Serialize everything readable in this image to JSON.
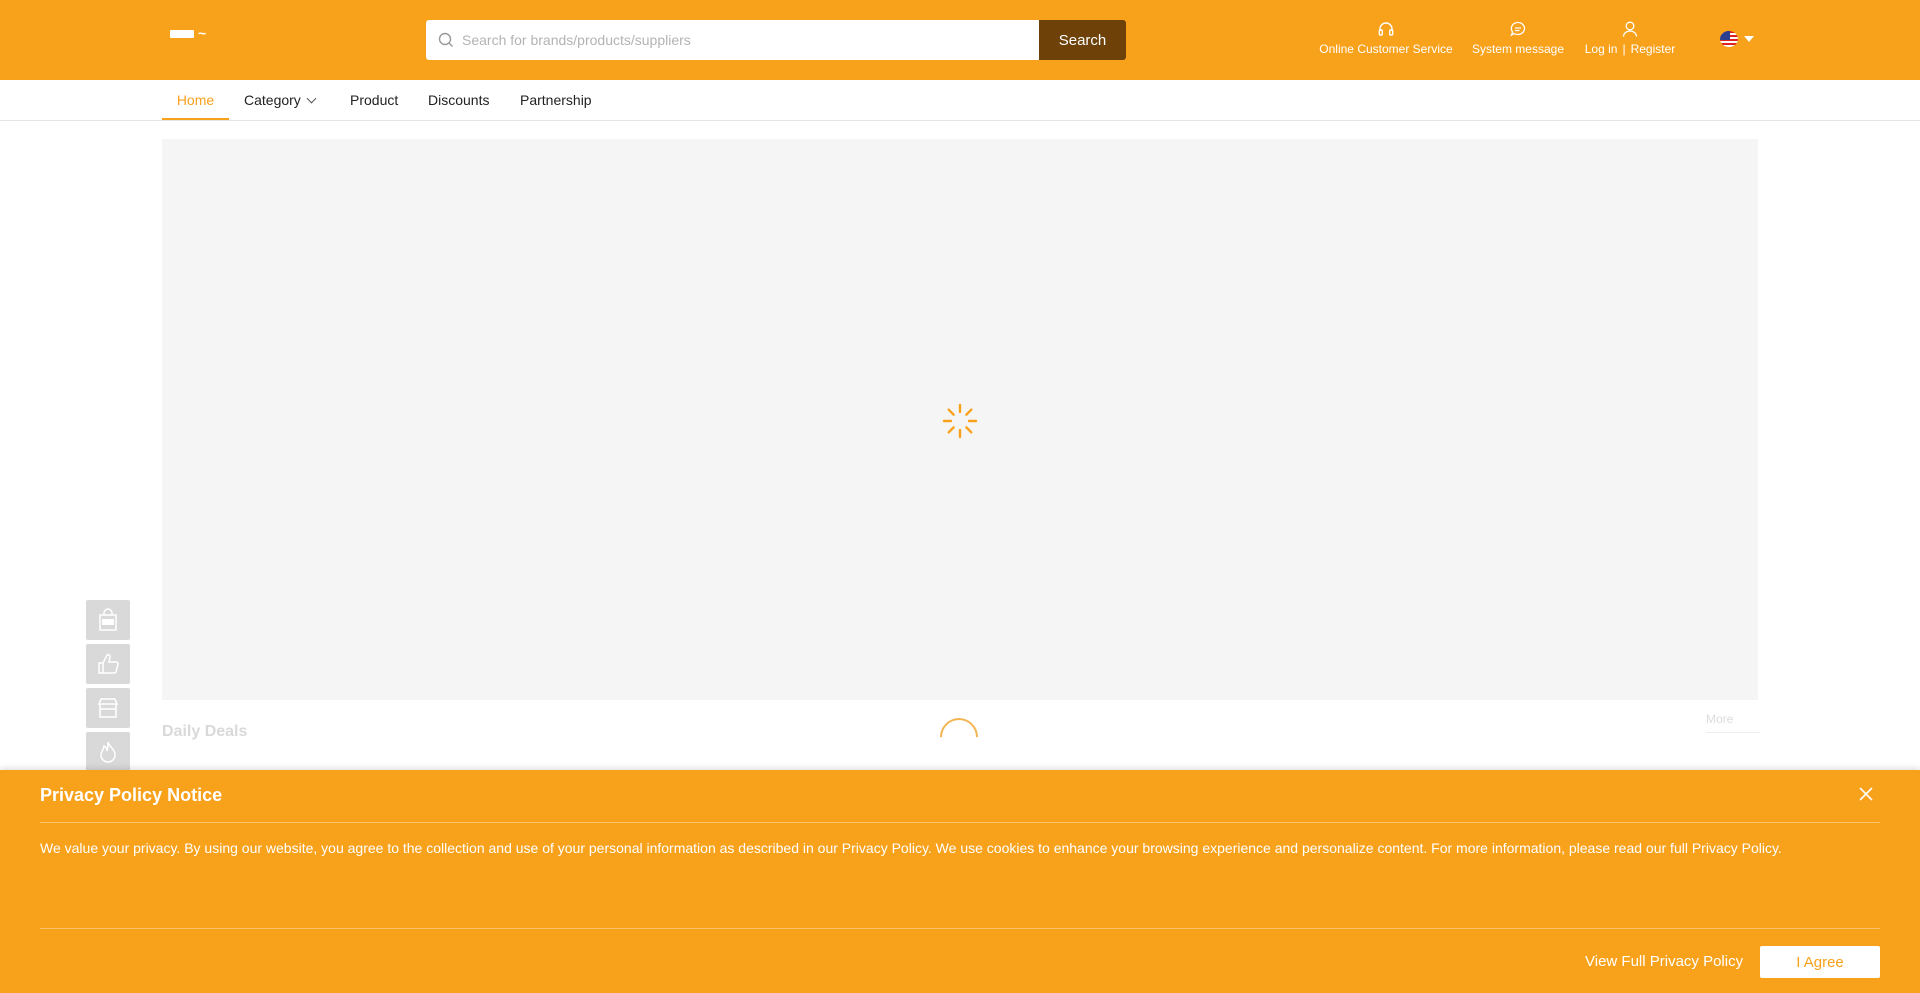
{
  "header": {
    "search": {
      "placeholder": "Search for brands/products/suppliers",
      "value": "",
      "button_label": "Search"
    },
    "customer_service_label": "Online Customer Service",
    "system_message_label": "System message",
    "login_label": "Log in",
    "login_separator": "|",
    "register_label": "Register",
    "language_flag": "us-flag-icon"
  },
  "nav": {
    "items": [
      {
        "label": "Home",
        "active": true
      },
      {
        "label": "Category",
        "active": false
      },
      {
        "label": "Product",
        "active": false
      },
      {
        "label": "Discounts",
        "active": false
      },
      {
        "label": "Partnership",
        "active": false
      }
    ]
  },
  "main": {
    "deals_title": "Daily Deals",
    "more_label": "More",
    "side_icons": [
      "new-bag-icon",
      "thumbs-up-icon",
      "store-icon",
      "hot-fire-icon"
    ]
  },
  "privacy": {
    "title": "Privacy Policy Notice",
    "text": "We value your privacy. By using our website, you agree to the collection and use of your personal information as described in our Privacy Policy. We use cookies to enhance your browsing experience and personalize content. For more information, please read our full Privacy Policy.",
    "view_full_label": "View Full Privacy Policy",
    "agree_label": "I Agree"
  },
  "colors": {
    "brand": "#f8a11b",
    "search_button": "#6e4109",
    "banner_bg": "#f5f5f5"
  }
}
